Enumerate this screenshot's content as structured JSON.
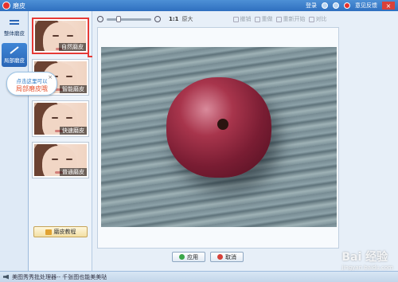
{
  "window": {
    "title": "磨皮",
    "login": "登录",
    "feedback": "意见反馈"
  },
  "rail": {
    "tabs": [
      {
        "label": "整体磨皮"
      },
      {
        "label": "局部磨皮"
      }
    ]
  },
  "thumbs": [
    {
      "label": "自然磨皮"
    },
    {
      "label": "智能磨皮"
    },
    {
      "label": "快速磨皮"
    },
    {
      "label": "普通磨皮"
    }
  ],
  "tutorial_label": "磨皮教程",
  "bubble": {
    "line1": "点击这里可以",
    "line2": "局部磨皮哦",
    "close": "×"
  },
  "toolbar": {
    "zoom_ratio": "1:1",
    "original": "原大",
    "undo": "撤销",
    "redo": "重做",
    "reset": "重新开始",
    "compare": "对比"
  },
  "buttons": {
    "apply": "应用",
    "cancel": "取消"
  },
  "statusbar": "美图秀秀批处理器-- 千张图也能美美哒",
  "watermark": {
    "brand": "Bai 经验",
    "url": "jingyan.baidu.com"
  }
}
